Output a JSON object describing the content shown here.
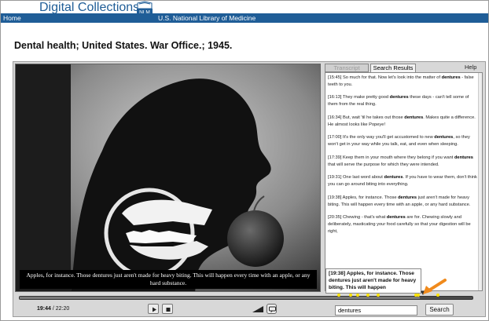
{
  "header": {
    "brand_title": "Digital Collections",
    "logo_text": "NLM",
    "subtitle": "U.S. National Library of Medicine",
    "home_link": "Home"
  },
  "page": {
    "title": "Dental health; United States. War Office.; 1945."
  },
  "video": {
    "caption": "Apples, for instance. Those dentures just aren't made for heavy biting. This will happen every time with an apple, or any hard substance."
  },
  "panel": {
    "tabs": [
      {
        "label": "Transcript",
        "active": false
      },
      {
        "label": "Search Results",
        "active": true
      }
    ],
    "help_label": "Help",
    "results": [
      {
        "time": "[15:45]",
        "before": " So much for that. Now let's look into the matter of ",
        "term": "dentures",
        "after": " - false teeth to you."
      },
      {
        "time": "[16:13]",
        "before": " They make pretty good ",
        "term": "dentures",
        "after": " these days - can't tell some of them from the real thing."
      },
      {
        "time": "[16:34]",
        "before": " But, wait 'til he takes out those ",
        "term": "dentures",
        "after": ". Makes quite a difference. He almost looks like Popeye!"
      },
      {
        "time": "[17:00]",
        "before": " It's the only way you'll get accustomed to new ",
        "term": "dentures",
        "after": ", so they won't get in your way while you talk, eat, and even when sleeping."
      },
      {
        "time": "[17:39]",
        "before": " Keep them in your mouth where they belong if you want ",
        "term": "dentures",
        "after": " that will serve the purpose for which they were intended."
      },
      {
        "time": "[19:31]",
        "before": " One last word about ",
        "term": "dentures",
        "after": ". If you have to wear them, don't think you can go around biting into everything."
      },
      {
        "time": "[19:38]",
        "before": " Apples, for instance. Those ",
        "term": "dentures",
        "after": " just aren't made for heavy biting. This will happen every time with an apple, or any hard substance."
      },
      {
        "time": "[20:35]",
        "before": " Chewing - that's what ",
        "term": "dentures",
        "after": " are for. Chewing slowly and deliberately, masticating your food carefully so that your digestion will be right,"
      }
    ]
  },
  "tooltip": {
    "text": "[19:38] Apples, for instance. Those dentures just aren't made for heavy biting. This will happen"
  },
  "player": {
    "current_time": "19:44",
    "separator": " / ",
    "duration": "22:20",
    "progress_fraction": 0.884,
    "hit_fractions": [
      0.705,
      0.73,
      0.745,
      0.769,
      0.791,
      0.874,
      0.879,
      0.922
    ]
  },
  "search": {
    "query": "dentures",
    "button_label": "Search"
  },
  "colors": {
    "brand_blue": "#1f5d97",
    "hit_marker": "#ffe400",
    "highlight_arrow": "#f08a1c"
  }
}
